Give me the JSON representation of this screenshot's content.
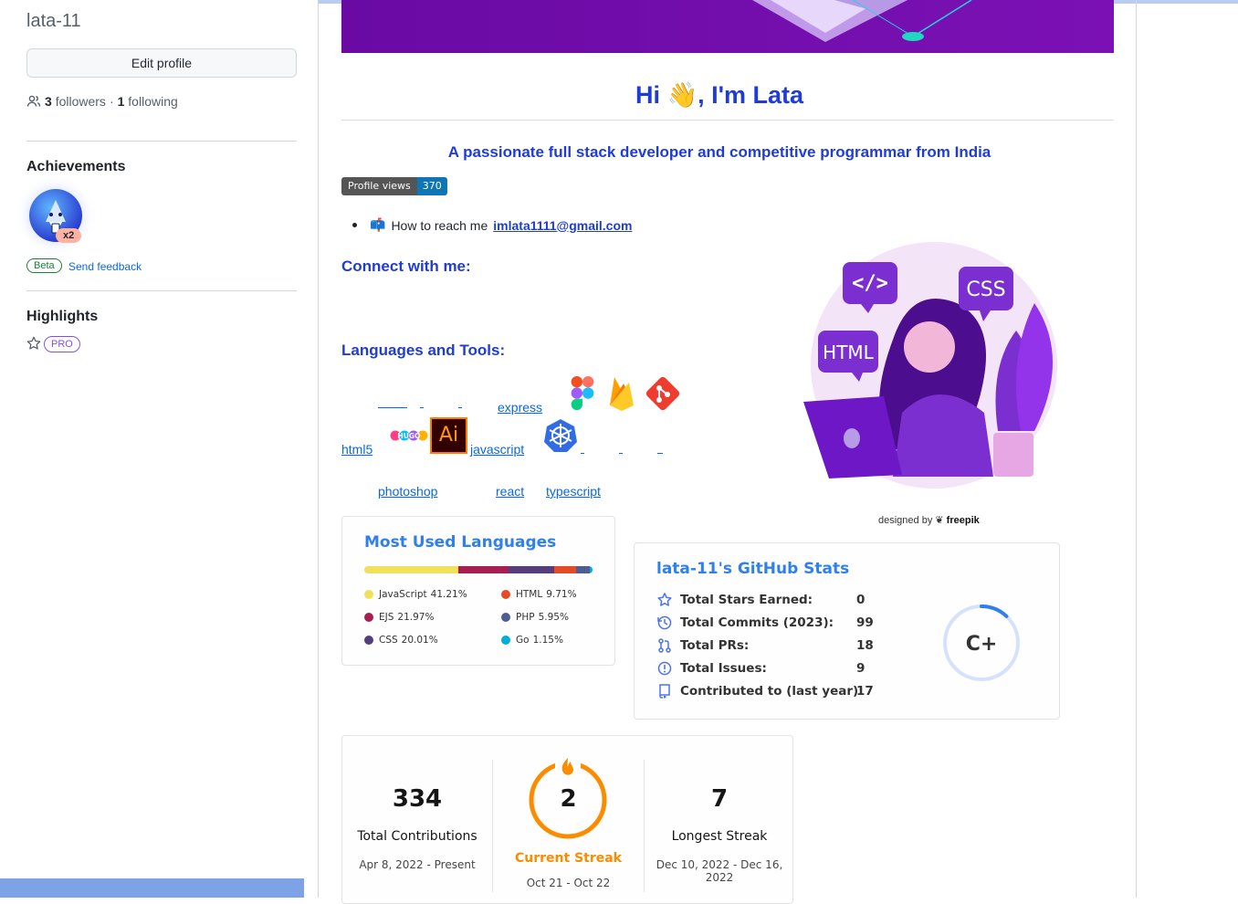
{
  "sidebar": {
    "username": "lata-11",
    "edit_profile": "Edit profile",
    "followers_count": "3",
    "followers_label": "followers",
    "separator": "·",
    "following_count": "1",
    "following_label": "following",
    "achievements_heading": "Achievements",
    "achievement_multiplier": "x2",
    "beta_label": "Beta",
    "send_feedback": "Send feedback",
    "highlights_heading": "Highlights",
    "pro_label": "PRO"
  },
  "readme": {
    "greeting": "Hi 👋, I'm Lata",
    "subtitle": "A passionate full stack developer and competitive programmar from India",
    "profile_views_label": "Profile views",
    "profile_views_value": "370",
    "reach_emoji": "📫",
    "reach_text": "How to reach me",
    "email": "imlata1111@gmail.com",
    "connect_heading": "Connect with me:",
    "languages_heading": "Languages and Tools:",
    "broken_images": {
      "express": "express",
      "html5": "html5",
      "javascript": "javascript",
      "photoshop": "photoshop",
      "react": "react",
      "typescript": "typescript"
    },
    "logo_icons": [
      "figma-icon",
      "firebase-icon",
      "git-icon",
      "hugo-icon",
      "illustrator-icon",
      "kubernetes-icon"
    ],
    "illustrator_label": "Ai",
    "hugo_label": "HUGO",
    "illustration_credit_prefix": "designed by",
    "illustration_credit_brand": "freepik",
    "illustration_tags": [
      "</>",
      "CSS",
      "HTML"
    ]
  },
  "top_langs": {
    "title": "Most Used Languages",
    "languages": [
      {
        "name": "JavaScript",
        "percent": "41.21%",
        "value": 41.21,
        "color": "#f1e05a"
      },
      {
        "name": "EJS",
        "percent": "21.97%",
        "value": 21.97,
        "color": "#a91e50"
      },
      {
        "name": "CSS",
        "percent": "20.01%",
        "value": 20.01,
        "color": "#563d7c"
      },
      {
        "name": "HTML",
        "percent": "9.71%",
        "value": 9.71,
        "color": "#e34c26"
      },
      {
        "name": "PHP",
        "percent": "5.95%",
        "value": 5.95,
        "color": "#4f5d95"
      },
      {
        "name": "Go",
        "percent": "1.15%",
        "value": 1.15,
        "color": "#00add8"
      }
    ]
  },
  "github_stats": {
    "title": "lata-11's GitHub Stats",
    "rows": [
      {
        "icon": "star-icon",
        "label": "Total Stars Earned:",
        "value": "0"
      },
      {
        "icon": "history-icon",
        "label": "Total Commits (2023):",
        "value": "99"
      },
      {
        "icon": "pull-request-icon",
        "label": "Total PRs:",
        "value": "18"
      },
      {
        "icon": "issue-icon",
        "label": "Total Issues:",
        "value": "9"
      },
      {
        "icon": "repo-icon",
        "label": "Contributed to (last year):",
        "value": "17"
      }
    ],
    "rank": "C+",
    "rank_progress": 0.12,
    "accent": "#2f80ed",
    "icon_color": "#4c71f2"
  },
  "streak": {
    "total": "334",
    "total_label": "Total Contributions",
    "total_range": "Apr 8, 2022 - Present",
    "current": "2",
    "current_label": "Current Streak",
    "current_range": "Oct 21 - Oct 22",
    "longest": "7",
    "longest_label": "Longest Streak",
    "longest_range": "Dec 10, 2022 - Dec 16, 2022",
    "accent": "#fb8c00"
  }
}
